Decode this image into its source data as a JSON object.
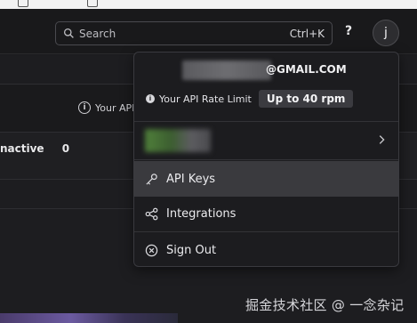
{
  "header": {
    "search_placeholder": "Search",
    "search_shortcut": "Ctrl+K",
    "help_label": "?",
    "avatar_initial": "j"
  },
  "background": {
    "rate_hint": "Your API",
    "inactive_label": "nactive",
    "inactive_count": "0"
  },
  "menu": {
    "email": "@GMAIL.COM",
    "rate_label": "Your API Rate Limit",
    "rate_value": "Up to 40 rpm",
    "items": [
      {
        "label": "API Keys",
        "icon": "key-icon"
      },
      {
        "label": "Integrations",
        "icon": "integrations-icon"
      },
      {
        "label": "Sign Out",
        "icon": "sign-out-icon"
      }
    ]
  },
  "watermark": "掘金技术社区 @ 一念杂记",
  "colors": {
    "background": "#1b1b1d",
    "menu_bg": "#1c1c1f",
    "active_item_bg": "#3a3a3e",
    "badge_bg": "#3b3b40"
  }
}
